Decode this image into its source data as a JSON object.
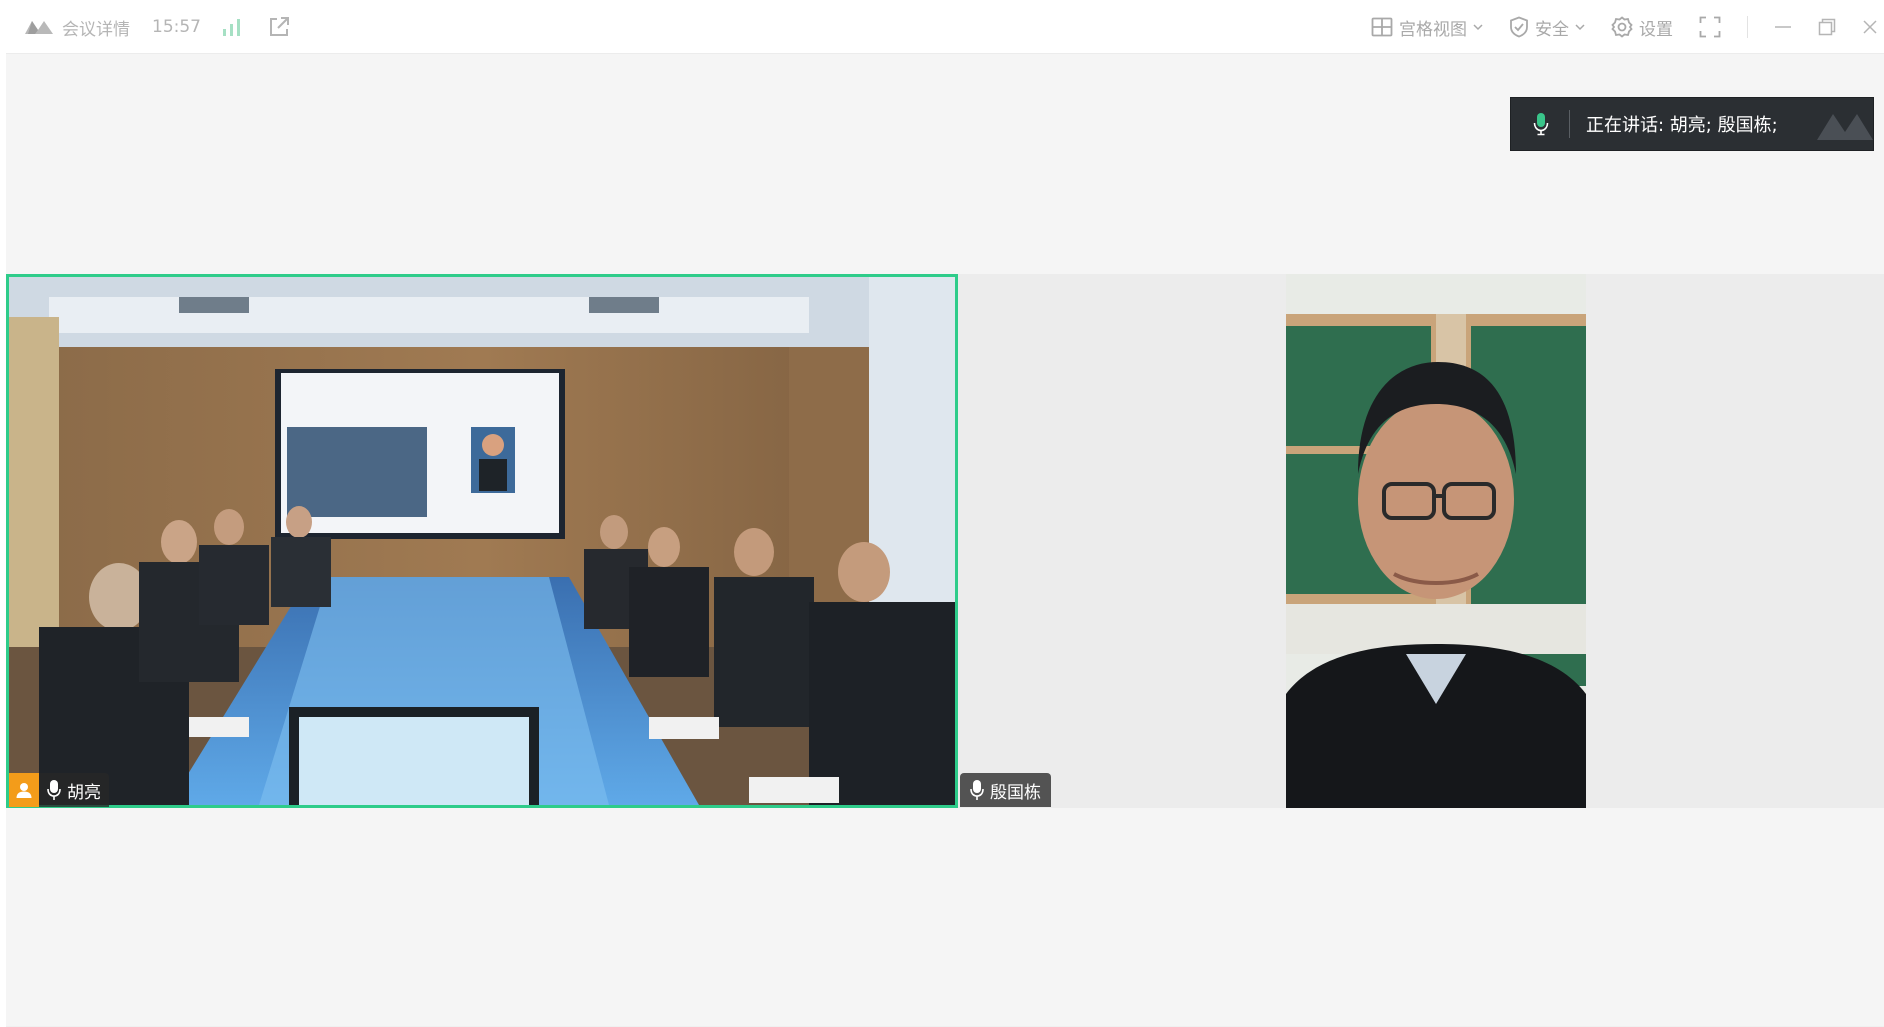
{
  "titlebar": {
    "meeting_info_label": "会议详情",
    "time": "15:57",
    "grid_view_label": "宫格视图",
    "security_label": "安全",
    "settings_label": "设置"
  },
  "speaking_banner": {
    "text": "正在讲话:  胡亮; 殷国栋;"
  },
  "participants": [
    {
      "name": "胡亮",
      "active_speaker": true
    },
    {
      "name": "殷国栋",
      "active_speaker": false
    }
  ],
  "colors": {
    "active_border": "#2ecc8a",
    "user_badge": "#f39c1a",
    "banner_bg": "#2b2f33",
    "mic_green": "#39c58a"
  },
  "icons": [
    "app-logo-icon",
    "signal-icon",
    "share-icon",
    "grid-icon",
    "shield-icon",
    "gear-icon",
    "fullscreen-icon",
    "minimize-icon",
    "restore-icon",
    "close-icon",
    "mic-icon",
    "user-icon"
  ]
}
